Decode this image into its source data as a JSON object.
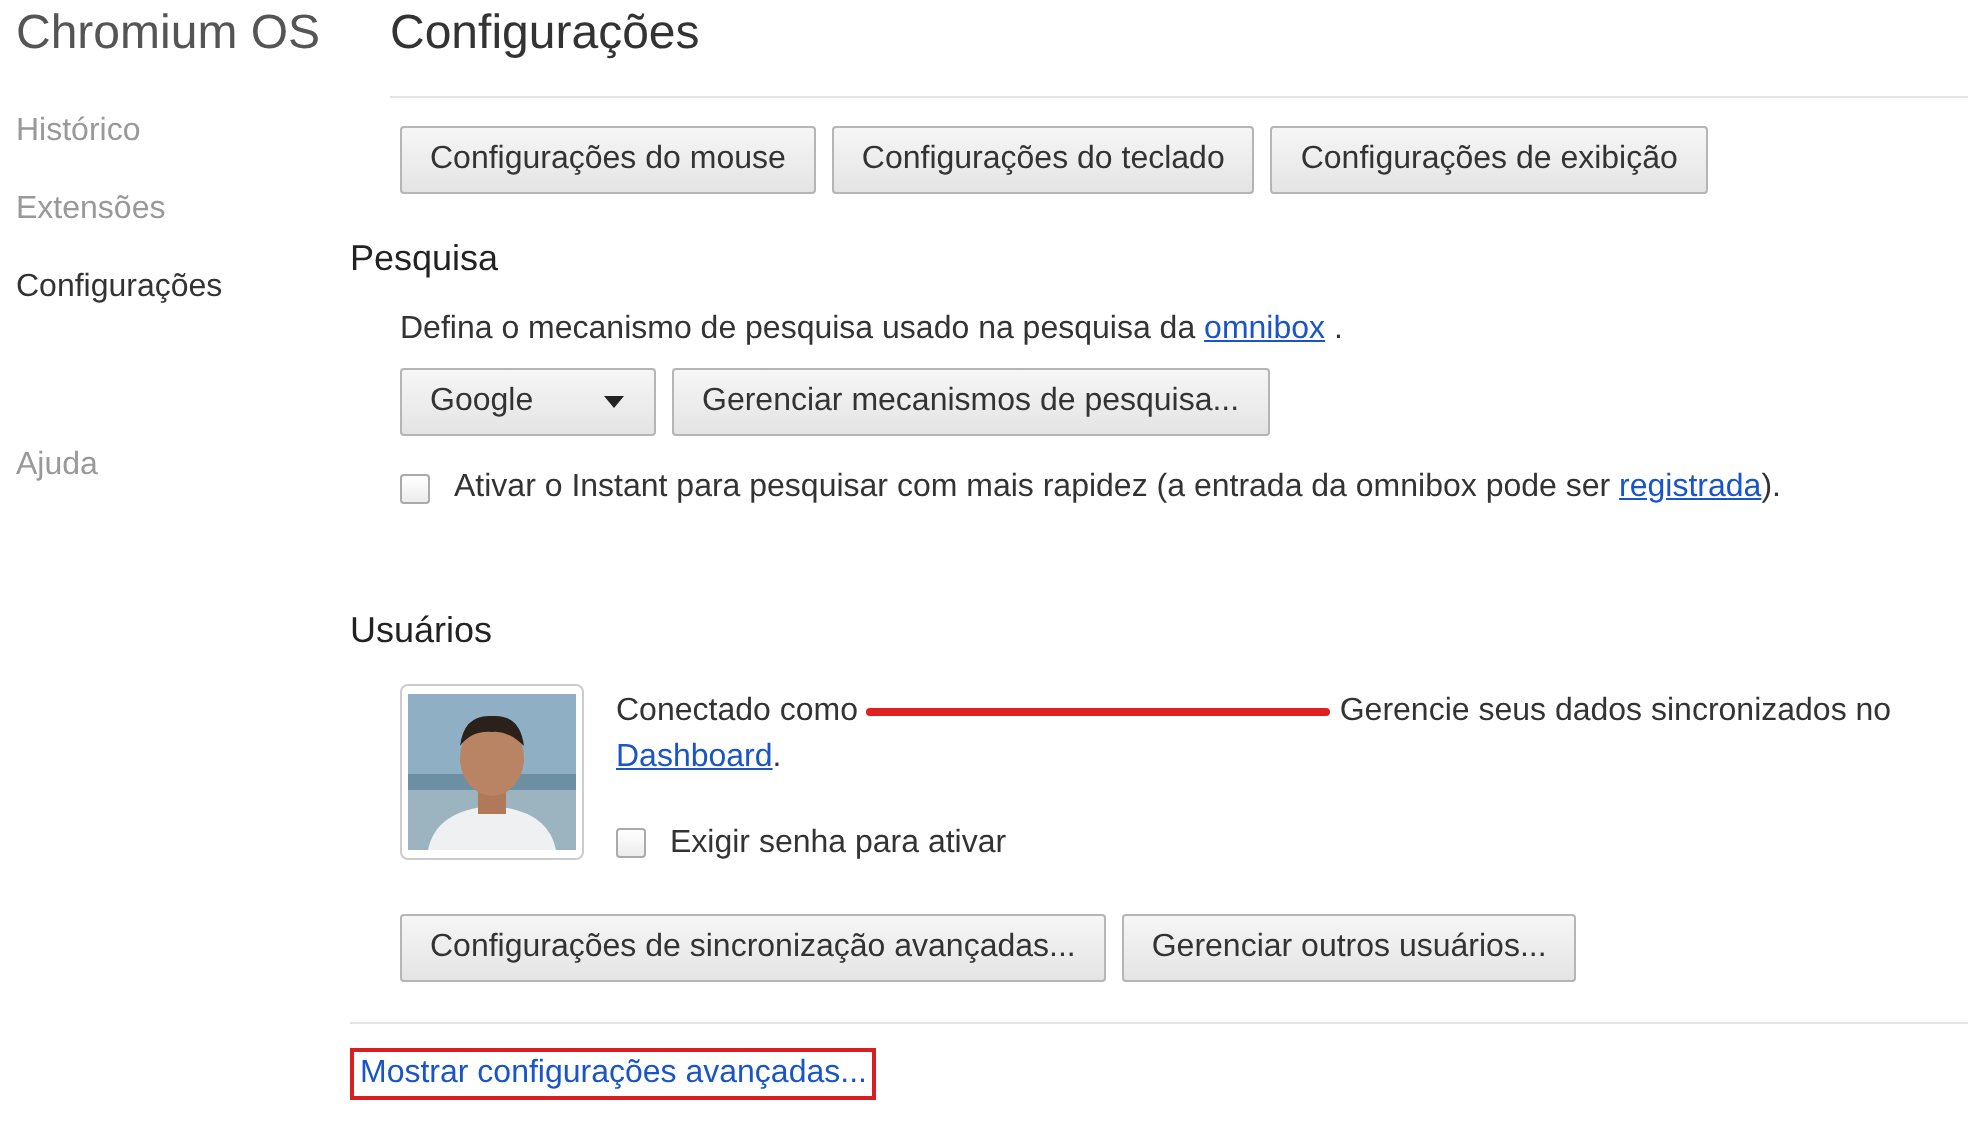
{
  "app_title": "Chromium OS",
  "page_title": "Configurações",
  "sidebar": {
    "items": [
      {
        "label": "Histórico",
        "selected": false
      },
      {
        "label": "Extensões",
        "selected": false
      },
      {
        "label": "Configurações",
        "selected": true
      },
      {
        "label": "Ajuda",
        "selected": false
      }
    ]
  },
  "device_buttons": [
    "Configurações do mouse",
    "Configurações do teclado",
    "Configurações de exibição"
  ],
  "search_section": {
    "heading": "Pesquisa",
    "description": "Defina o mecanismo de pesquisa usado na pesquisa da",
    "description_link": "omnibox",
    "description_end": ".",
    "engine": "Google",
    "manage_button": "Gerenciar mecanismos de pesquisa...",
    "instant": {
      "label": "Ativar o Instant para pesquisar com mais rapidez (a entrada da omnibox pode ser",
      "link": "registrada",
      "end": ").",
      "checked": false
    }
  },
  "users_section": {
    "heading": "Usuários",
    "avatar": {
      "kind": "picture"
    },
    "connected_prefix": "Conectado como",
    "email_redacted": true,
    "connected_suffix": "Gerencie seus dados sincronizados no",
    "dashboard_link": "Dashboard",
    "dashboard_end": ".",
    "require_password": {
      "label": "Exigir senha para ativar",
      "checked": false
    },
    "buttons": [
      "Configurações de sincronização avançadas...",
      "Gerenciar outros usuários..."
    ]
  },
  "advanced_link": {
    "label": "Mostrar configurações avançadas...",
    "highlighted": true
  }
}
